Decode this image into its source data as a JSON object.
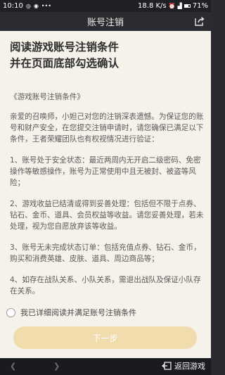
{
  "status_bar": {
    "time": "10:10",
    "network_speed": "18.8 K/s",
    "battery": "71%"
  },
  "header": {
    "title": "账号注销",
    "share_icon": "share-icon"
  },
  "content": {
    "heading_line1": "阅读游戏账号注销条件",
    "heading_line2": "并在页面底部勾选确认",
    "doc_title": "《游戏账号注销条件》",
    "paragraphs": [
      "亲爱的召唤师，小妲己对您的注销深表遗憾。为保证您的账号和财产安全，在您提交注销申请时，请您确保已满足以下条件，王者荣耀团队也有权视情况进行验证：",
      "1、账号处于安全状态：最近两周内无开启二级密码、免密操作等敏感操作，账号为正常使用中且无被封、被盗等风险；",
      "2、游戏收益已结清或得到妥善处理：包括但不限于点券、钻石、金币、道具、会员权益等收益。请您妥善处理，若未处理，视为您自愿放弃该等收益。",
      "3、账号无未完成状态订单：包括充值点券、钻石、金币，购买和消费英雄、皮肤、道具、周边商品等；",
      "4、如存在战队关系、小队关系，需退出战队及保证小队存在关系。"
    ]
  },
  "agreement": {
    "label": "我已详细阅读并满足账号注销条件",
    "checked": false
  },
  "actions": {
    "next_label": "下一步"
  },
  "nav": {
    "back_icon": "chevron-left-icon",
    "forward_icon": "chevron-right-icon",
    "return_label": "返回游戏"
  },
  "colors": {
    "page_bg": "#f5f2ea",
    "header_bg": "#2b2c31",
    "button_bg": "#f0dcac"
  }
}
